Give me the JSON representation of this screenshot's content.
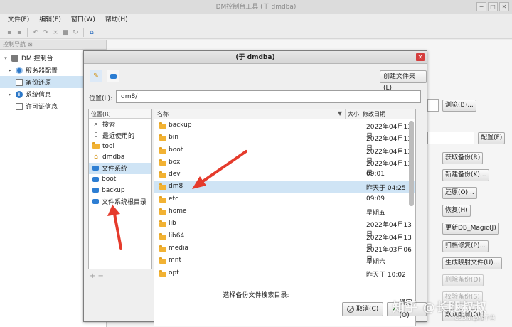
{
  "window": {
    "title": "DM控制台工具 (于 dmdba)",
    "min_glyph": "−",
    "max_glyph": "□",
    "close_glyph": "✕"
  },
  "menu": [
    "文件(F)",
    "编辑(E)",
    "窗口(W)",
    "帮助(H)"
  ],
  "toolbar": {
    "icons": [
      "save-icon",
      "save-all-icon",
      "undo-icon",
      "redo-icon",
      "delete-icon",
      "stop-icon",
      "refresh-icon",
      "home-icon"
    ],
    "home_glyph": "⌂"
  },
  "side_panel": {
    "tab_label": "控制导航",
    "tab_close": "⊠",
    "tree": [
      {
        "label": "DM 控制台",
        "icon": "database-icon",
        "twisty": "▾",
        "indent": 0,
        "selected": false
      },
      {
        "label": "服务器配置",
        "icon": "gear-icon",
        "twisty": "▸",
        "indent": 1,
        "selected": false
      },
      {
        "label": "备份还原",
        "icon": "backup-icon",
        "twisty": "",
        "indent": 1,
        "selected": true
      },
      {
        "label": "系统信息",
        "icon": "info-icon",
        "twisty": "▸",
        "indent": 1,
        "selected": false
      },
      {
        "label": "许可证信息",
        "icon": "document-icon",
        "twisty": "",
        "indent": 1,
        "selected": false
      }
    ]
  },
  "right_panel": {
    "buttons": [
      {
        "label": "浏览(B)...",
        "enabled": true
      },
      {
        "label": "配置(F)",
        "enabled": true
      },
      {
        "label": "获取备份(R)",
        "enabled": true
      },
      {
        "label": "新建备份(K)...",
        "enabled": true
      },
      {
        "label": "还原(O)...",
        "enabled": true
      },
      {
        "label": "恢复(H)",
        "enabled": true
      },
      {
        "label": "更新DB_Magic(J)",
        "enabled": true
      },
      {
        "label": "归档修复(P)...",
        "enabled": true
      },
      {
        "label": "生成映射文件(U)...",
        "enabled": true
      },
      {
        "label": "删除备份(D)",
        "enabled": false
      },
      {
        "label": "校验备份(S)",
        "enabled": false
      },
      {
        "label": "默认配置(G)",
        "enabled": true
      }
    ]
  },
  "dialog": {
    "title": "(于 dmdba)",
    "close_glyph": "✕",
    "edit_glyph": "✎",
    "create_folder_label": "创建文件夹(L)",
    "location_label": "位置(L):",
    "location_value": "dm8/",
    "places_header": "位置(R)",
    "places": [
      {
        "label": "搜索",
        "icon": "search-icon",
        "selected": false
      },
      {
        "label": "最近使用的",
        "icon": "recent-icon",
        "selected": false
      },
      {
        "label": "tool",
        "icon": "folder-icon",
        "selected": false
      },
      {
        "label": "dmdba",
        "icon": "home-icon",
        "selected": false
      },
      {
        "label": "文件系统",
        "icon": "drive-icon",
        "selected": true
      },
      {
        "label": "boot",
        "icon": "drive-icon",
        "selected": false
      },
      {
        "label": "backup",
        "icon": "drive-icon",
        "selected": false
      },
      {
        "label": "文件系统根目录",
        "icon": "drive-icon",
        "selected": false
      }
    ],
    "places_controls": "+  −",
    "columns": {
      "name": "名称",
      "sort_glyph": "▼",
      "size": "大小",
      "modified": "修改日期"
    },
    "files": [
      {
        "name": "backup",
        "modified": "2022年04月13日",
        "selected": false
      },
      {
        "name": "bin",
        "modified": "2022年04月13日",
        "selected": false
      },
      {
        "name": "boot",
        "modified": "2022年04月13日",
        "selected": false
      },
      {
        "name": "box",
        "modified": "2022年04月13日",
        "selected": false
      },
      {
        "name": "dev",
        "modified": "09:01",
        "selected": false
      },
      {
        "name": "dm8",
        "modified": "昨天于 04:25",
        "selected": true
      },
      {
        "name": "etc",
        "modified": "09:09",
        "selected": false
      },
      {
        "name": "home",
        "modified": "星期五",
        "selected": false
      },
      {
        "name": "lib",
        "modified": "2022年04月13日",
        "selected": false
      },
      {
        "name": "lib64",
        "modified": "2022年04月13日",
        "selected": false
      },
      {
        "name": "media",
        "modified": "2021年03月06日",
        "selected": false
      },
      {
        "name": "mnt",
        "modified": "星期六",
        "selected": false
      },
      {
        "name": "opt",
        "modified": "昨天于 10:02",
        "selected": false
      }
    ],
    "footer_text": "选择备份文件搜索目录:",
    "cancel_label": "取消(C)",
    "ok_label": "确定(O)",
    "ok_glyph": "✔"
  },
  "watermark": {
    "text": "知乎 @长腿叔叔",
    "sub": "CSDN @橘子巷"
  },
  "colors": {
    "selection": "#cfe4f5",
    "folder": "#f2b233",
    "annotation_arrow": "#e53b2c",
    "close_button": "#d53d3d"
  }
}
